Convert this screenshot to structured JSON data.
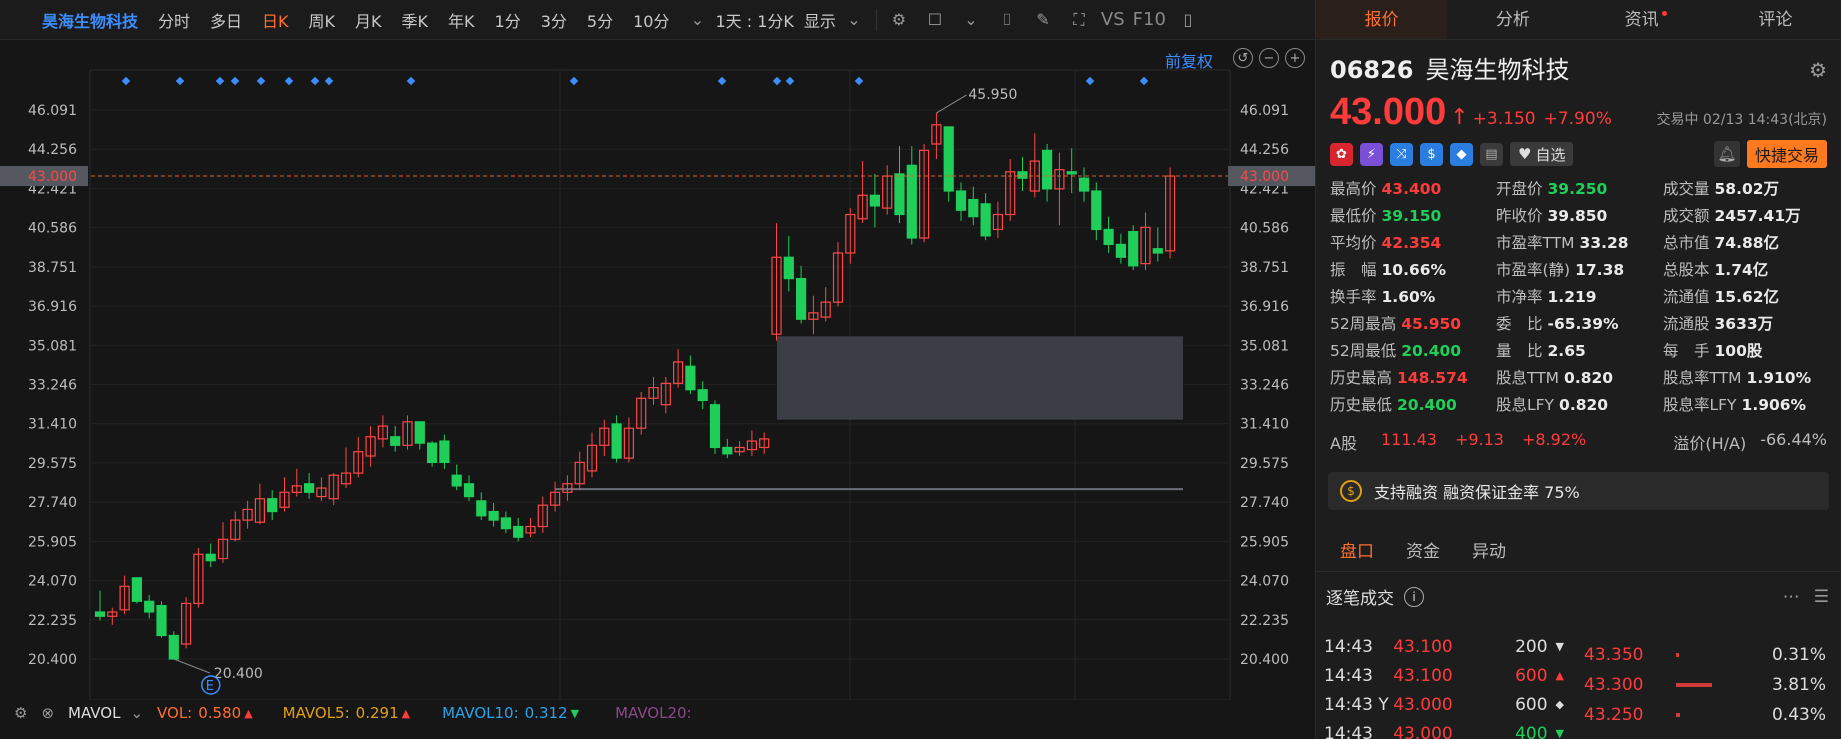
{
  "toolbar": {
    "stock_name": "昊海生物科技",
    "periods": [
      "分时",
      "多日",
      "日K",
      "周K",
      "月K",
      "季K",
      "年K",
      "1分",
      "3分",
      "5分",
      "10分"
    ],
    "active_period": "日K",
    "interval": "1天 : 1分K",
    "display": "显示",
    "vs": "VS",
    "f10": "F10"
  },
  "chart": {
    "fq_label": "前复权",
    "y_ticks": [
      "46.091",
      "44.256",
      "42.421",
      "40.586",
      "38.751",
      "36.916",
      "35.081",
      "33.246",
      "31.410",
      "29.575",
      "27.740",
      "25.905",
      "24.070",
      "22.235",
      "20.400"
    ],
    "current_price_label": "43.000",
    "max_label": "45.950",
    "min_label": "20.400",
    "event_marker": "E"
  },
  "chart_data": {
    "type": "candlestick",
    "ylim": [
      20.4,
      46.091
    ],
    "current": 43.0,
    "candles": [
      {
        "o": 22.6,
        "c": 22.4,
        "h": 23.6,
        "l": 22.2
      },
      {
        "o": 22.4,
        "c": 22.6,
        "h": 22.8,
        "l": 22.0
      },
      {
        "o": 22.7,
        "c": 23.8,
        "h": 24.3,
        "l": 22.5
      },
      {
        "o": 24.2,
        "c": 23.1,
        "h": 24.2,
        "l": 23.0
      },
      {
        "o": 23.1,
        "c": 22.6,
        "h": 23.4,
        "l": 22.3
      },
      {
        "o": 22.9,
        "c": 21.5,
        "h": 23.1,
        "l": 21.4
      },
      {
        "o": 21.5,
        "c": 20.4,
        "h": 21.7,
        "l": 20.4
      },
      {
        "o": 21.1,
        "c": 23.0,
        "h": 23.3,
        "l": 20.9
      },
      {
        "o": 23.0,
        "c": 25.3,
        "h": 25.6,
        "l": 22.8
      },
      {
        "o": 25.3,
        "c": 25.0,
        "h": 25.8,
        "l": 24.7
      },
      {
        "o": 25.1,
        "c": 26.0,
        "h": 26.8,
        "l": 24.9
      },
      {
        "o": 26.0,
        "c": 26.9,
        "h": 27.3,
        "l": 25.9
      },
      {
        "o": 26.9,
        "c": 27.4,
        "h": 27.8,
        "l": 26.5
      },
      {
        "o": 26.8,
        "c": 27.9,
        "h": 28.6,
        "l": 26.7
      },
      {
        "o": 27.9,
        "c": 27.3,
        "h": 28.3,
        "l": 26.9
      },
      {
        "o": 27.5,
        "c": 28.2,
        "h": 28.9,
        "l": 27.3
      },
      {
        "o": 28.2,
        "c": 28.5,
        "h": 29.3,
        "l": 28.0
      },
      {
        "o": 28.6,
        "c": 28.2,
        "h": 29.1,
        "l": 27.9
      },
      {
        "o": 28.0,
        "c": 28.4,
        "h": 28.9,
        "l": 27.8
      },
      {
        "o": 27.9,
        "c": 29.0,
        "h": 29.1,
        "l": 27.6
      },
      {
        "o": 28.6,
        "c": 29.1,
        "h": 30.3,
        "l": 28.4
      },
      {
        "o": 29.1,
        "c": 30.1,
        "h": 30.8,
        "l": 28.9
      },
      {
        "o": 29.9,
        "c": 30.8,
        "h": 31.3,
        "l": 29.4
      },
      {
        "o": 30.7,
        "c": 31.3,
        "h": 31.8,
        "l": 30.3
      },
      {
        "o": 30.8,
        "c": 30.4,
        "h": 31.3,
        "l": 30.1
      },
      {
        "o": 30.4,
        "c": 31.5,
        "h": 31.8,
        "l": 30.2
      },
      {
        "o": 31.5,
        "c": 30.5,
        "h": 31.5,
        "l": 30.2
      },
      {
        "o": 30.5,
        "c": 29.6,
        "h": 30.6,
        "l": 29.4
      },
      {
        "o": 30.6,
        "c": 29.6,
        "h": 30.9,
        "l": 29.3
      },
      {
        "o": 29.0,
        "c": 28.5,
        "h": 29.5,
        "l": 28.3
      },
      {
        "o": 28.6,
        "c": 28.0,
        "h": 29.0,
        "l": 27.8
      },
      {
        "o": 27.8,
        "c": 27.1,
        "h": 28.2,
        "l": 26.9
      },
      {
        "o": 27.3,
        "c": 26.9,
        "h": 27.7,
        "l": 26.6
      },
      {
        "o": 27.0,
        "c": 26.5,
        "h": 27.3,
        "l": 26.3
      },
      {
        "o": 26.6,
        "c": 26.1,
        "h": 27.0,
        "l": 25.9
      },
      {
        "o": 26.3,
        "c": 26.6,
        "h": 27.0,
        "l": 26.1
      },
      {
        "o": 26.6,
        "c": 27.6,
        "h": 28.0,
        "l": 26.3
      },
      {
        "o": 27.6,
        "c": 28.2,
        "h": 28.7,
        "l": 27.3
      },
      {
        "o": 28.2,
        "c": 28.6,
        "h": 29.0,
        "l": 27.8
      },
      {
        "o": 28.6,
        "c": 29.6,
        "h": 30.1,
        "l": 28.3
      },
      {
        "o": 29.2,
        "c": 30.4,
        "h": 31.0,
        "l": 28.9
      },
      {
        "o": 30.4,
        "c": 31.2,
        "h": 31.6,
        "l": 29.9
      },
      {
        "o": 31.4,
        "c": 29.8,
        "h": 31.8,
        "l": 29.6
      },
      {
        "o": 29.8,
        "c": 31.2,
        "h": 31.7,
        "l": 29.6
      },
      {
        "o": 31.2,
        "c": 32.6,
        "h": 32.9,
        "l": 30.9
      },
      {
        "o": 32.6,
        "c": 33.1,
        "h": 33.6,
        "l": 32.3
      },
      {
        "o": 32.3,
        "c": 33.3,
        "h": 33.6,
        "l": 31.9
      },
      {
        "o": 33.3,
        "c": 34.3,
        "h": 34.9,
        "l": 33.1
      },
      {
        "o": 34.1,
        "c": 33.0,
        "h": 34.6,
        "l": 32.8
      },
      {
        "o": 33.0,
        "c": 32.5,
        "h": 33.4,
        "l": 32.1
      },
      {
        "o": 32.3,
        "c": 30.3,
        "h": 32.5,
        "l": 30.0
      },
      {
        "o": 30.3,
        "c": 30.0,
        "h": 30.7,
        "l": 29.8
      },
      {
        "o": 30.1,
        "c": 30.3,
        "h": 30.6,
        "l": 29.9
      },
      {
        "o": 30.2,
        "c": 30.6,
        "h": 31.1,
        "l": 29.9
      },
      {
        "o": 30.3,
        "c": 30.7,
        "h": 31.0,
        "l": 30.0
      },
      {
        "o": 35.6,
        "c": 39.2,
        "h": 40.8,
        "l": 35.3
      },
      {
        "o": 39.2,
        "c": 38.2,
        "h": 40.2,
        "l": 37.6
      },
      {
        "o": 38.2,
        "c": 36.3,
        "h": 38.8,
        "l": 36.1
      },
      {
        "o": 36.3,
        "c": 36.6,
        "h": 37.4,
        "l": 35.6
      },
      {
        "o": 36.4,
        "c": 37.1,
        "h": 37.8,
        "l": 36.2
      },
      {
        "o": 37.1,
        "c": 39.4,
        "h": 39.9,
        "l": 36.9
      },
      {
        "o": 39.4,
        "c": 41.2,
        "h": 41.5,
        "l": 38.9
      },
      {
        "o": 41.0,
        "c": 42.1,
        "h": 43.7,
        "l": 40.8
      },
      {
        "o": 42.1,
        "c": 41.6,
        "h": 43.1,
        "l": 40.6
      },
      {
        "o": 41.5,
        "c": 43.0,
        "h": 43.5,
        "l": 41.2
      },
      {
        "o": 43.1,
        "c": 41.2,
        "h": 44.4,
        "l": 40.8
      },
      {
        "o": 43.5,
        "c": 40.1,
        "h": 44.4,
        "l": 39.8
      },
      {
        "o": 40.1,
        "c": 44.2,
        "h": 44.5,
        "l": 39.9
      },
      {
        "o": 44.5,
        "c": 45.4,
        "h": 45.95,
        "l": 43.8
      },
      {
        "o": 45.3,
        "c": 42.3,
        "h": 45.3,
        "l": 41.8
      },
      {
        "o": 42.3,
        "c": 41.4,
        "h": 42.7,
        "l": 40.9
      },
      {
        "o": 41.9,
        "c": 41.1,
        "h": 42.5,
        "l": 40.7
      },
      {
        "o": 41.7,
        "c": 40.2,
        "h": 42.2,
        "l": 40.0
      },
      {
        "o": 40.5,
        "c": 41.2,
        "h": 41.8,
        "l": 40.1
      },
      {
        "o": 41.2,
        "c": 43.2,
        "h": 43.8,
        "l": 40.9
      },
      {
        "o": 43.2,
        "c": 42.9,
        "h": 43.9,
        "l": 42.3
      },
      {
        "o": 42.3,
        "c": 43.7,
        "h": 45.0,
        "l": 42.0
      },
      {
        "o": 44.2,
        "c": 42.4,
        "h": 44.5,
        "l": 41.8
      },
      {
        "o": 42.4,
        "c": 43.3,
        "h": 44.1,
        "l": 40.7
      },
      {
        "o": 43.2,
        "c": 43.1,
        "h": 44.3,
        "l": 42.2
      },
      {
        "o": 42.9,
        "c": 42.3,
        "h": 43.4,
        "l": 41.8
      },
      {
        "o": 42.3,
        "c": 40.5,
        "h": 42.7,
        "l": 40.0
      },
      {
        "o": 40.5,
        "c": 39.8,
        "h": 41.1,
        "l": 39.4
      },
      {
        "o": 39.8,
        "c": 39.2,
        "h": 40.3,
        "l": 38.9
      },
      {
        "o": 40.4,
        "c": 38.8,
        "h": 40.7,
        "l": 38.6
      },
      {
        "o": 38.9,
        "c": 40.6,
        "h": 41.3,
        "l": 38.6
      },
      {
        "o": 39.6,
        "c": 39.4,
        "h": 40.6,
        "l": 39.0
      },
      {
        "o": 39.5,
        "c": 43.0,
        "h": 43.4,
        "l": 39.15
      }
    ]
  },
  "volume_bar": {
    "indicator": "MAVOL",
    "vol_label": "VOL:",
    "vol_value": "0.580",
    "ma5_label": "MAVOL5:",
    "ma5_value": "0.291",
    "ma10_label": "MAVOL10:",
    "ma10_value": "0.312",
    "ma20_label": "MAVOL20:"
  },
  "side": {
    "tabs": [
      "报价",
      "分析",
      "资讯",
      "评论"
    ],
    "code": "06826",
    "name": "昊海生物科技",
    "price": "43.000",
    "change": "+3.150",
    "change_pct": "+7.90%",
    "status": "交易中 02/13 14:43(北京)",
    "watch_label": "自选",
    "quick_trade": "快捷交易",
    "stats": [
      {
        "label": "最高价",
        "value": "43.400",
        "color": "red"
      },
      {
        "label": "开盘价",
        "value": "39.250",
        "color": "green"
      },
      {
        "label": "成交量",
        "value": "58.02万",
        "color": ""
      },
      {
        "label": "最低价",
        "value": "39.150",
        "color": "green"
      },
      {
        "label": "昨收价",
        "value": "39.850",
        "color": ""
      },
      {
        "label": "成交额",
        "value": "2457.41万",
        "color": ""
      },
      {
        "label": "平均价",
        "value": "42.354",
        "color": "red"
      },
      {
        "label": "市盈率TTM",
        "value": "33.28",
        "color": ""
      },
      {
        "label": "总市值",
        "value": "74.88亿",
        "color": ""
      },
      {
        "label": "振　幅",
        "value": "10.66%",
        "color": ""
      },
      {
        "label": "市盈率(静)",
        "value": "17.38",
        "color": ""
      },
      {
        "label": "总股本",
        "value": "1.74亿",
        "color": ""
      },
      {
        "label": "换手率",
        "value": "1.60%",
        "color": ""
      },
      {
        "label": "市净率",
        "value": "1.219",
        "color": ""
      },
      {
        "label": "流通值",
        "value": "15.62亿",
        "color": ""
      },
      {
        "label": "52周最高",
        "value": "45.950",
        "color": "red"
      },
      {
        "label": "委　比",
        "value": "-65.39%",
        "color": ""
      },
      {
        "label": "流通股",
        "value": "3633万",
        "color": ""
      },
      {
        "label": "52周最低",
        "value": "20.400",
        "color": "green"
      },
      {
        "label": "量　比",
        "value": "2.65",
        "color": ""
      },
      {
        "label": "每　手",
        "value": "100股",
        "color": ""
      },
      {
        "label": "历史最高",
        "value": "148.574",
        "color": "red"
      },
      {
        "label": "股息TTM",
        "value": "0.820",
        "color": ""
      },
      {
        "label": "股息率TTM",
        "value": "1.910%",
        "color": ""
      },
      {
        "label": "历史最低",
        "value": "20.400",
        "color": "green"
      },
      {
        "label": "股息LFY",
        "value": "0.820",
        "color": ""
      },
      {
        "label": "股息率LFY",
        "value": "1.906%",
        "color": ""
      }
    ],
    "a_share": {
      "label": "A股",
      "price": "111.43",
      "change": "+9.13",
      "pct": "+8.92%",
      "premium_label": "溢价(H/A)",
      "premium": "-66.44%"
    },
    "margin_text": "支持融资 融资保证金率 75%",
    "sub_tabs": [
      "盘口",
      "资金",
      "异动"
    ],
    "trades_title": "逐笔成交",
    "trades": [
      {
        "time": "14:43",
        "price": "43.100",
        "vol": "200",
        "dir": "▼",
        "vc": "#ddd"
      },
      {
        "time": "14:43",
        "price": "43.100",
        "vol": "600",
        "dir": "▲",
        "vc": "#ff3b3b"
      },
      {
        "time": "14:43 Y",
        "price": "43.000",
        "vol": "600",
        "dir": "◆",
        "vc": "#ddd"
      },
      {
        "time": "14:43",
        "price": "43.000",
        "vol": "400",
        "dir": "▼",
        "vc": "#1fcf5a"
      }
    ],
    "depth": [
      {
        "price": "43.350",
        "pct": "0.31%",
        "w": 3
      },
      {
        "price": "43.300",
        "pct": "3.81%",
        "w": 36
      },
      {
        "price": "43.250",
        "pct": "0.43%",
        "w": 4
      }
    ]
  }
}
